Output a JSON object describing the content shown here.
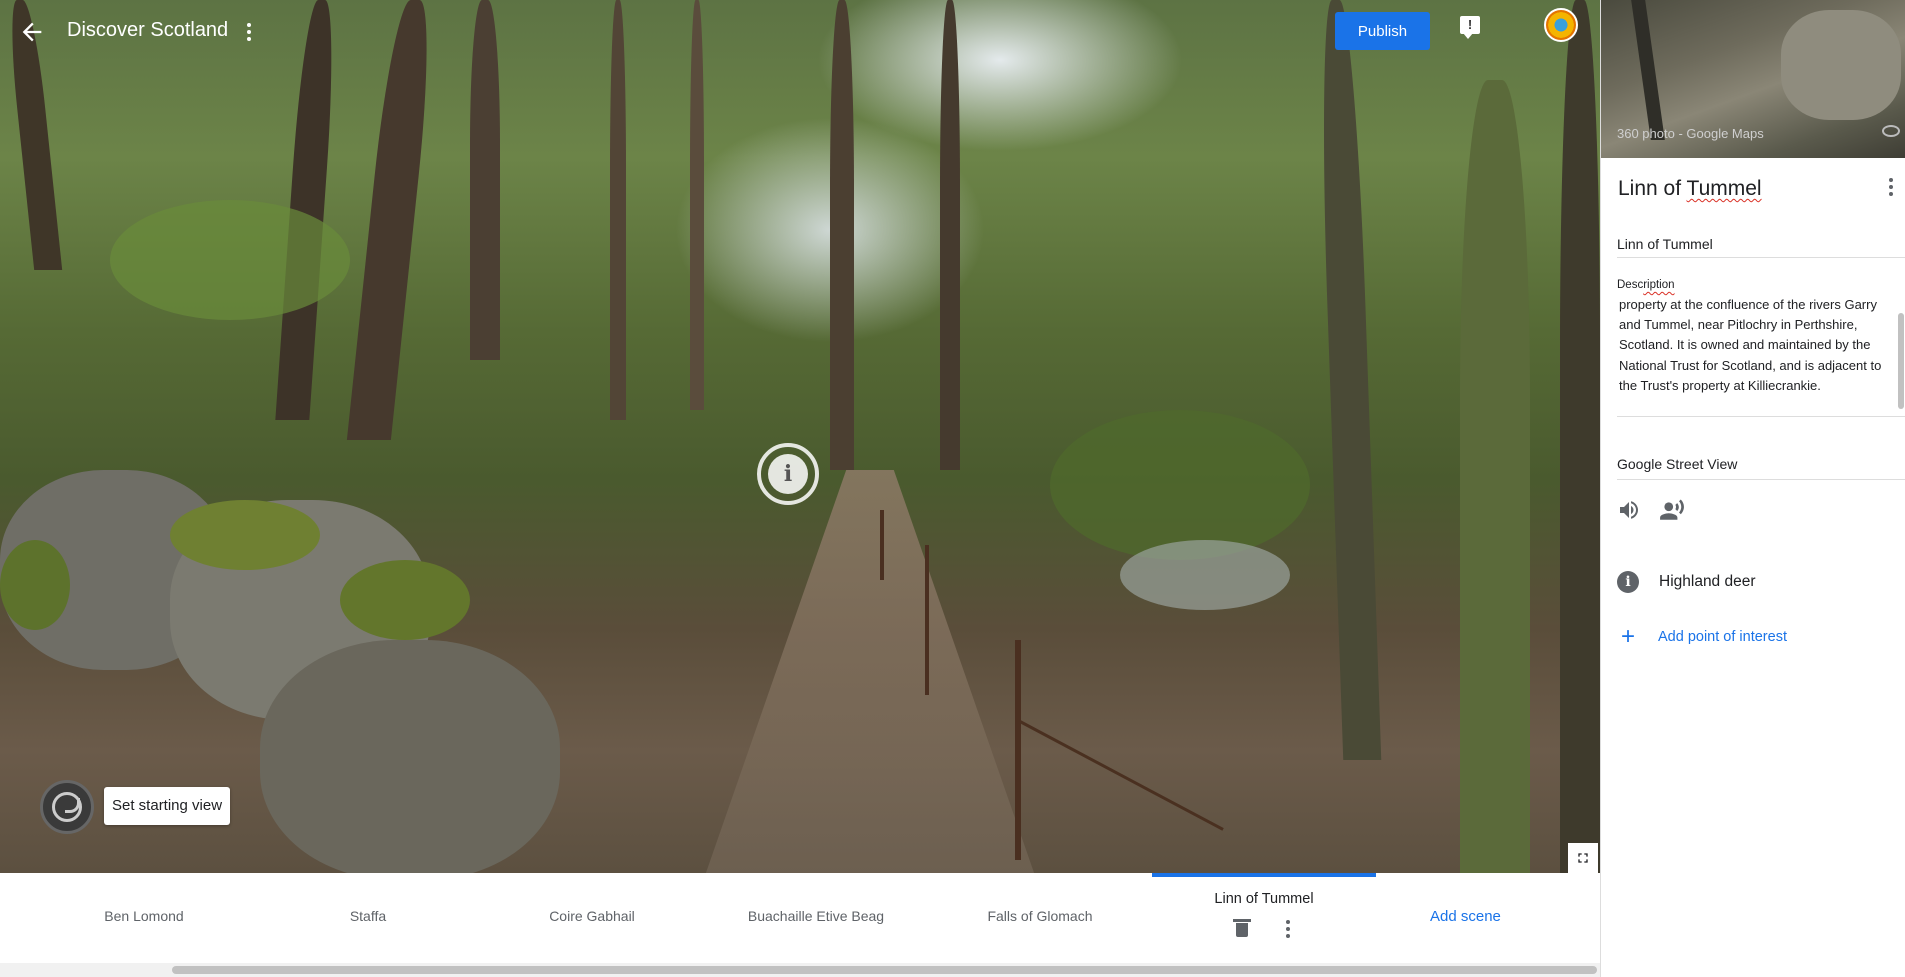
{
  "header": {
    "title": "Discover Scotland",
    "publish_label": "Publish",
    "feedback_glyph": "!"
  },
  "viewer": {
    "set_start_label": "Set starting view",
    "hotspot_glyph": "i"
  },
  "scenes": [
    {
      "label": "Ben Lomond",
      "active": false
    },
    {
      "label": "Staffa",
      "active": false
    },
    {
      "label": "Coire Gabhail",
      "active": false
    },
    {
      "label": "Buachaille Etive Beag",
      "active": false
    },
    {
      "label": "Falls of Glomach",
      "active": false
    },
    {
      "label": "Linn of Tummel",
      "active": true
    }
  ],
  "add_scene_label": "Add scene",
  "panel": {
    "preview_credit": "360 photo - Google Maps",
    "scene_title_prefix": "Linn of ",
    "scene_title_word": "Tummel",
    "title_field": "Linn of Tummel",
    "description_label_prefix": "Desc",
    "description_label_word": "ription",
    "description_text": "property at the confluence of the rivers Garry and Tummel, near Pitlochry in Perthshire, Scotland. It is owned and maintained by the National Trust for Scotland, and is adjacent to the Trust's property at Killiecrankie.",
    "street_view_label": "Google Street View",
    "poi_label": "Highland deer",
    "poi_glyph": "i",
    "add_poi_label": "Add point of interest",
    "add_poi_glyph": "+"
  },
  "colors": {
    "accent": "#1a73e8",
    "publish_bg": "#1a73e8",
    "text_primary": "#202124",
    "text_secondary": "#5f6368"
  },
  "icons": {
    "back": "arrow-left-icon",
    "menu": "more-vert-icon",
    "feedback": "feedback-icon",
    "avatar": "account-avatar",
    "hotspot": "info-icon",
    "start_view": "set-start-view-icon",
    "fullscreen": "fullscreen-icon",
    "delete": "trash-icon",
    "audio": "volume-icon",
    "narration": "record-voice-icon",
    "poi": "info-icon",
    "add": "plus-icon"
  }
}
